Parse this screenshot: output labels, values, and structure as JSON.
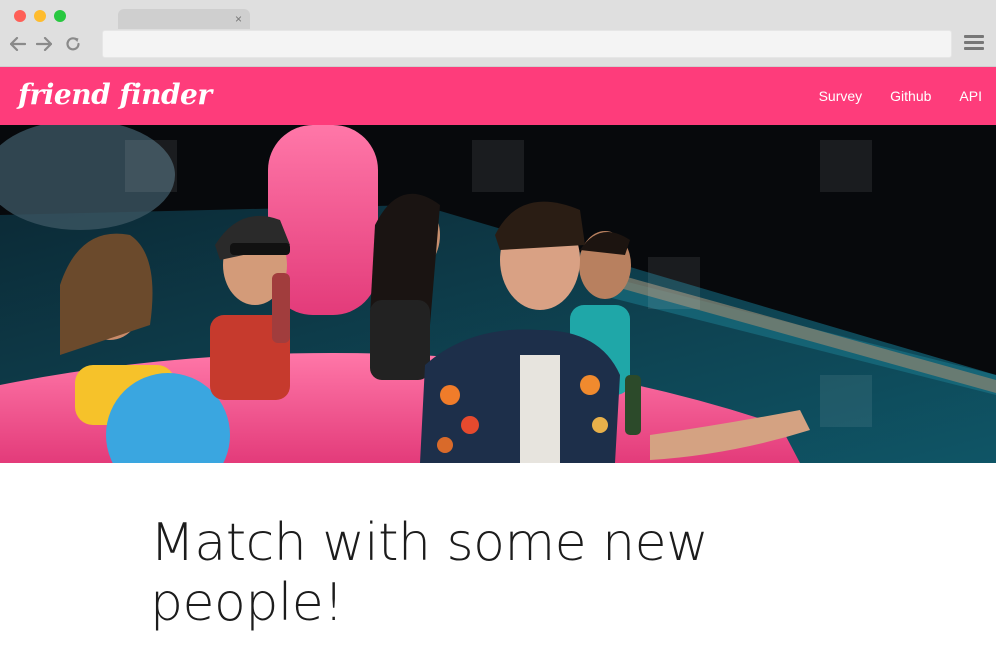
{
  "browser": {
    "tab_close_glyph": "×",
    "icons": [
      "back-arrow-icon",
      "forward-arrow-icon",
      "reload-icon",
      "hamburger-menu-icon"
    ],
    "traffic_light_colors": [
      "#fe5f57",
      "#febc2e",
      "#28c840"
    ]
  },
  "navbar": {
    "brand": "friend finder",
    "background": "#fe3c7b",
    "links": [
      "Survey",
      "Github",
      "API"
    ]
  },
  "hero": {
    "subject": "photo"
  },
  "main": {
    "headline": "Match with some new people!"
  }
}
